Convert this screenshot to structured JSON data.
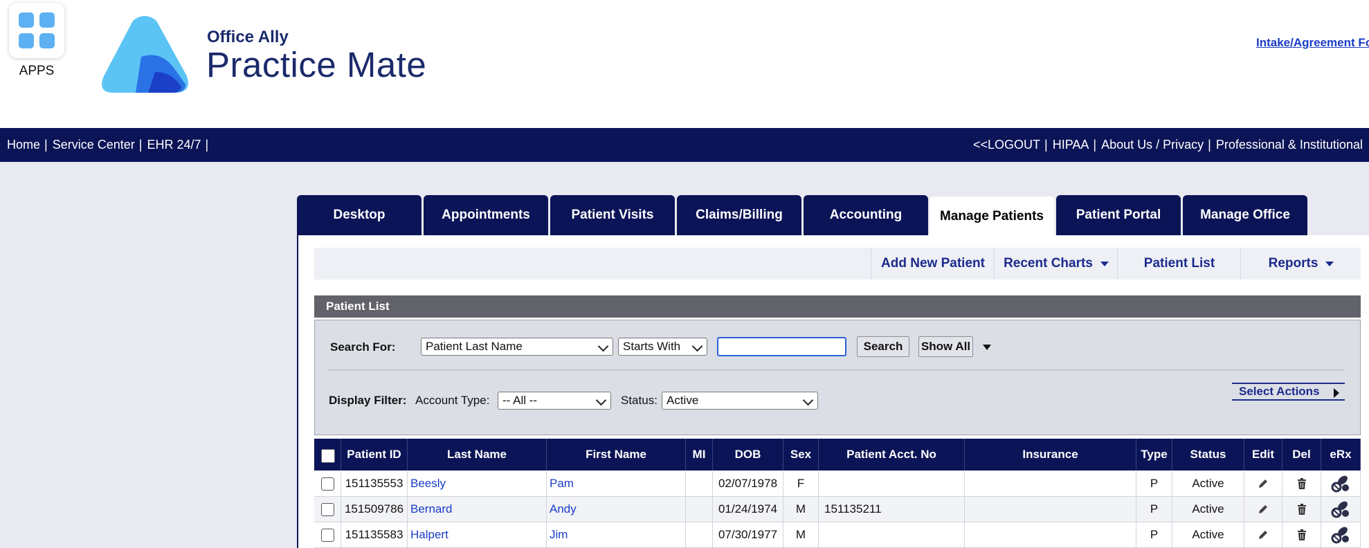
{
  "header": {
    "apps_label": "APPS",
    "logo_sub": "Office Ally",
    "logo_title": "Practice Mate",
    "intake_link": "Intake/Agreement Fo"
  },
  "nav": {
    "left": [
      "Home",
      "Service Center",
      "EHR 24/7"
    ],
    "right": [
      "<<LOGOUT",
      "HIPAA",
      "About Us / Privacy",
      "Professional & Institutional"
    ],
    "separator": "|"
  },
  "tabs": [
    "Desktop",
    "Appointments",
    "Patient Visits",
    "Claims/Billing",
    "Accounting",
    "Manage Patients",
    "Patient Portal",
    "Manage Office"
  ],
  "active_tab": "Manage Patients",
  "subbar": {
    "add_new": "Add New Patient",
    "recent_charts": "Recent Charts",
    "patient_list": "Patient List",
    "reports": "Reports"
  },
  "patient_list": {
    "title": "Patient List",
    "search_label": "Search For:",
    "search_field": "Patient Last Name",
    "search_mode": "Starts With",
    "search_value": "",
    "search_button": "Search",
    "show_all_button": "Show All",
    "display_filter_label": "Display Filter:",
    "account_type_label": "Account Type:",
    "account_type_value": "-- All --",
    "status_label": "Status:",
    "status_value": "Active",
    "select_actions": "Select Actions"
  },
  "table": {
    "headers": [
      "Patient ID",
      "Last Name",
      "First Name",
      "MI",
      "DOB",
      "Sex",
      "Patient Acct. No",
      "Insurance",
      "Type",
      "Status",
      "Edit",
      "Del",
      "eRx"
    ],
    "rows": [
      {
        "id": "151135553",
        "last": "Beesly",
        "first": "Pam",
        "mi": "",
        "dob": "02/07/1978",
        "sex": "F",
        "acct": "",
        "insurance": "",
        "type": "P",
        "status": "Active"
      },
      {
        "id": "151509786",
        "last": "Bernard",
        "first": "Andy",
        "mi": "",
        "dob": "01/24/1974",
        "sex": "M",
        "acct": "151135211",
        "insurance": "",
        "type": "P",
        "status": "Active"
      },
      {
        "id": "151135583",
        "last": "Halpert",
        "first": "Jim",
        "mi": "",
        "dob": "07/30/1977",
        "sex": "M",
        "acct": "",
        "insurance": "",
        "type": "P",
        "status": "Active"
      }
    ]
  },
  "colors": {
    "navy": "#0b1457",
    "link_blue": "#1a3cc7",
    "page_bg": "#e9eaf1"
  }
}
